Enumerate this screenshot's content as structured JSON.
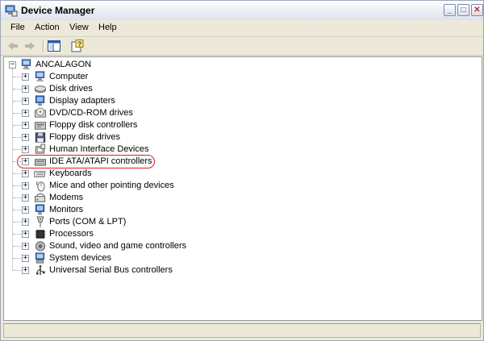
{
  "window": {
    "title": "Device Manager"
  },
  "menu": {
    "file": "File",
    "action": "Action",
    "view": "View",
    "help": "Help"
  },
  "toolbar": {
    "back_icon": "back-arrow-icon",
    "forward_icon": "forward-arrow-icon",
    "show_hide_tree_icon": "console-tree-icon",
    "properties_icon": "properties-help-icon"
  },
  "tree": {
    "root": {
      "label": "ANCALAGON",
      "icon": "computer-icon",
      "expander": "−"
    },
    "items": [
      {
        "label": "Computer",
        "icon": "computer-icon"
      },
      {
        "label": "Disk drives",
        "icon": "disk-drive-icon"
      },
      {
        "label": "Display adapters",
        "icon": "display-adapter-icon"
      },
      {
        "label": "DVD/CD-ROM drives",
        "icon": "cdrom-icon"
      },
      {
        "label": "Floppy disk controllers",
        "icon": "floppy-controller-icon"
      },
      {
        "label": "Floppy disk drives",
        "icon": "floppy-drive-icon"
      },
      {
        "label": "Human Interface Devices",
        "icon": "hid-icon"
      },
      {
        "label": "IDE ATA/ATAPI controllers",
        "icon": "ide-controller-icon",
        "highlighted": true
      },
      {
        "label": "Keyboards",
        "icon": "keyboard-icon"
      },
      {
        "label": "Mice and other pointing devices",
        "icon": "mouse-icon"
      },
      {
        "label": "Modems",
        "icon": "modem-icon"
      },
      {
        "label": "Monitors",
        "icon": "monitor-icon"
      },
      {
        "label": "Ports (COM & LPT)",
        "icon": "port-icon"
      },
      {
        "label": "Processors",
        "icon": "processor-icon"
      },
      {
        "label": "Sound, video and game controllers",
        "icon": "sound-icon"
      },
      {
        "label": "System devices",
        "icon": "system-devices-icon"
      },
      {
        "label": "Universal Serial Bus controllers",
        "icon": "usb-icon"
      }
    ],
    "expander_symbol": "+"
  },
  "colors": {
    "highlight_ring": "#d92020",
    "title_bar": "#eef0f6"
  }
}
